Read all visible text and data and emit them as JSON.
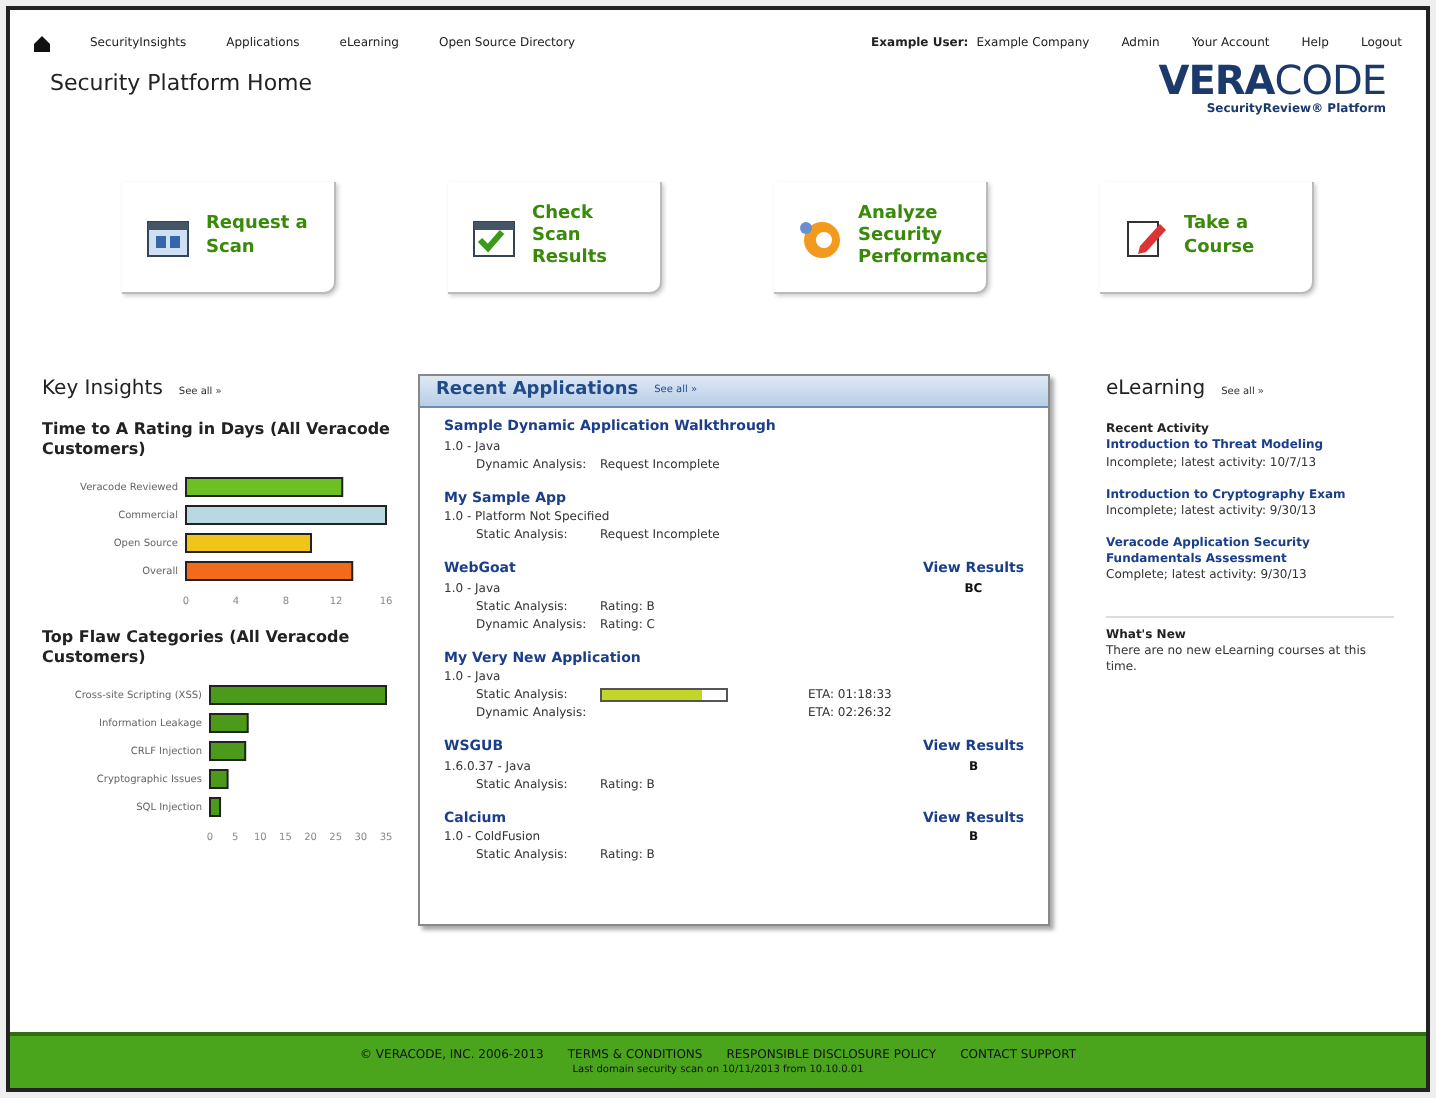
{
  "nav": {
    "links": [
      {
        "label": "SecurityInsights"
      },
      {
        "label": "Applications"
      },
      {
        "label": "eLearning"
      },
      {
        "label": "Open Source Directory"
      }
    ],
    "user_label": "Example User:",
    "company": "Example Company",
    "right_links": [
      {
        "label": "Admin"
      },
      {
        "label": "Your Account"
      },
      {
        "label": "Help"
      },
      {
        "label": "Logout"
      }
    ]
  },
  "page_title": "Security Platform Home",
  "logo": {
    "strong": "VERA",
    "light": "CODE",
    "tagline": "SecurityReview® Platform"
  },
  "actions": [
    {
      "kind": "request",
      "label": "Request a Scan"
    },
    {
      "kind": "check",
      "label": "Check Scan Results"
    },
    {
      "kind": "analyze",
      "label": "Analyze Security Performance"
    },
    {
      "kind": "course",
      "label": "Take a Course"
    }
  ],
  "key_insights": {
    "title": "Key Insights",
    "see_all": "See all »",
    "charts": [
      {
        "chart_data": {
          "type": "bar",
          "orientation": "horizontal",
          "stacked": true,
          "title": "Time to A Rating in Days (All Veracode Customers)",
          "categories": [
            "Veracode Reviewed",
            "Commercial",
            "Open Source",
            "Overall"
          ],
          "series": [
            {
              "color": "#6cc024",
              "values": [
                12.5,
                null,
                null,
                null
              ]
            },
            {
              "color": "#b9d9e0",
              "values": [
                null,
                16,
                null,
                null
              ]
            },
            {
              "color": "#f0c419",
              "values": [
                null,
                null,
                10,
                null
              ]
            },
            {
              "color": "#f26a1b",
              "values": [
                null,
                null,
                null,
                13.3
              ]
            }
          ],
          "xlim": [
            0,
            16
          ],
          "xticks": [
            0,
            4,
            8,
            12,
            16
          ]
        }
      },
      {
        "chart_data": {
          "type": "bar",
          "orientation": "horizontal",
          "stacked": true,
          "title": "Top Flaw Categories (All Veracode Customers)",
          "categories": [
            "Cross-site Scripting (XSS)",
            "Information Leakage",
            "CRLF Injection",
            "Cryptographic Issues",
            "SQL Injection"
          ],
          "series": [
            {
              "color": "#4c9a1a",
              "values": [
                35,
                7.5,
                7,
                3.5,
                2
              ]
            }
          ],
          "xlim": [
            0,
            35
          ],
          "xticks": [
            0,
            5,
            10,
            15,
            20,
            25,
            30,
            35
          ]
        }
      }
    ]
  },
  "recent_apps": {
    "title": "Recent Applications",
    "see_all": "See all »",
    "apps": [
      {
        "name": "Sample Dynamic Application Walkthrough",
        "version": "1.0 - Java",
        "results": [
          {
            "label": "Dynamic Analysis:",
            "value": "Request Incomplete"
          }
        ]
      },
      {
        "name": "My Sample App",
        "version": "1.0 - Platform Not Specified",
        "results": [
          {
            "label": "Static Analysis:",
            "value": "Request Incomplete"
          }
        ]
      },
      {
        "name": "WebGoat",
        "version": "1.0 - Java",
        "view": "View Results",
        "grade": "BC",
        "results": [
          {
            "label": "Static Analysis:",
            "value": "Rating: B"
          },
          {
            "label": "Dynamic Analysis:",
            "value": "Rating: C"
          }
        ]
      },
      {
        "name": "My Very New Application",
        "version": "1.0 - Java",
        "results": [
          {
            "label": "Static Analysis:",
            "level": 0.8,
            "eta": "ETA: 01:18:33"
          },
          {
            "label": "Dynamic Analysis:",
            "eta": "ETA: 02:26:32"
          }
        ]
      },
      {
        "name": "WSGUB",
        "version": "1.6.0.37 - Java",
        "view": "View Results",
        "grade": "B",
        "results": [
          {
            "label": "Static Analysis:",
            "value": "Rating: B"
          }
        ]
      },
      {
        "name": "Calcium",
        "version": "1.0 - ColdFusion",
        "view": "View Results",
        "grade": "B",
        "results": [
          {
            "label": "Static Analysis:",
            "value": "Rating: B"
          }
        ]
      }
    ]
  },
  "elearning": {
    "title": "eLearning",
    "see_all": "See all »",
    "recent_heading": "Recent Activity",
    "courses": [
      {
        "name": "Introduction to Threat Modeling",
        "status": "Incomplete; latest activity: 10/7/13"
      },
      {
        "name": "Introduction to Cryptography Exam",
        "status": "Incomplete; latest activity: 9/30/13"
      },
      {
        "name": "Veracode Application Security Fundamentals Assessment",
        "status": "Complete; latest activity: 9/30/13"
      }
    ],
    "whats_new_heading": "What's New",
    "whats_new_text": "There are no new eLearning courses at this time."
  },
  "footer": {
    "links": [
      {
        "label": "© VERACODE, INC. 2006-2013"
      },
      {
        "label": "TERMS & CONDITIONS"
      },
      {
        "label": "RESPONSIBLE DISCLOSURE POLICY"
      },
      {
        "label": "CONTACT SUPPORT"
      }
    ],
    "note": "Last domain security scan on 10/11/2013 from 10.10.0.01"
  }
}
